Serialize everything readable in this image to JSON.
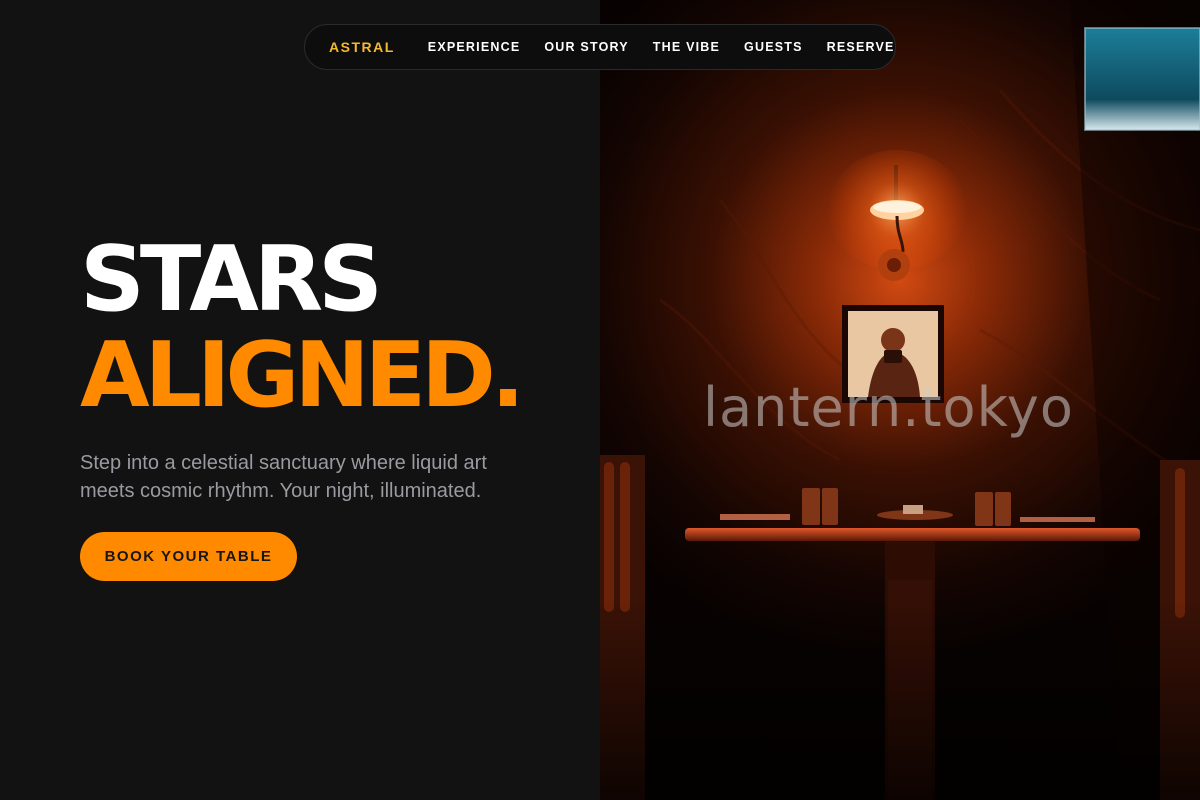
{
  "nav": {
    "brand": "ASTRAL",
    "links": [
      {
        "label": "EXPERIENCE"
      },
      {
        "label": "OUR STORY"
      },
      {
        "label": "THE VIBE"
      },
      {
        "label": "GUESTS"
      },
      {
        "label": "RESERVE"
      }
    ]
  },
  "hero": {
    "headline_line1": "STARS",
    "headline_line2": "ALIGNED.",
    "subtitle": "Step into a celestial sanctuary where liquid art meets cosmic rhythm. Your night, illuminated.",
    "cta_label": "BOOK YOUR TABLE"
  },
  "photo": {
    "watermark": "lantern.tokyo"
  },
  "colors": {
    "background": "#121212",
    "accent": "#ff8a00",
    "brand": "#f5b82e",
    "text": "#ffffff",
    "muted": "#9a9aa0"
  }
}
